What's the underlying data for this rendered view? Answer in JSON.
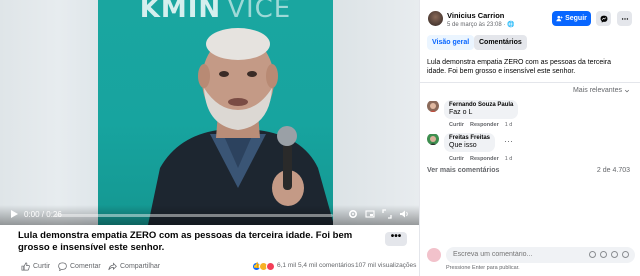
{
  "video": {
    "brand_text": "KMIN",
    "brand_text_right": "VICE",
    "time_display": "0:00 / 0:26",
    "progress_fraction": 0.0,
    "controls": [
      "play-icon",
      "volume-icon",
      "settings-icon",
      "pip-icon",
      "fullscreen-icon",
      "expand-icon"
    ]
  },
  "post": {
    "caption": "Lula demonstra empatia ZERO com as pessoas da terceira idade. Foi bem grosso e insensível este senhor.",
    "more_label": "•••",
    "actions": {
      "like": "Curtir",
      "comment": "Comentar",
      "share": "Compartilhar"
    },
    "reactions_count": "6,1 mil",
    "comments_count": "5,4 mil comentários",
    "views": "107 mil visualizações"
  },
  "panel": {
    "author": "Vinicius Carrion",
    "timestamp": "5 de março às 23:08 · 🌐",
    "follow_label": "Seguir",
    "tabs": [
      "Visão geral",
      "Comentários"
    ],
    "description": "Lula demonstra empatia ZERO com as pessoas da terceira idade. Foi bem grosso e insensível este senhor.",
    "sort_label": "Mais relevantes",
    "comments": [
      {
        "name": "Fernando Souza Paula",
        "text": "Faz o L",
        "like": "Curtir",
        "reply": "Responder",
        "age": "1 d"
      },
      {
        "name": "Freitas Freitas",
        "text": "Que isso",
        "like": "Curtir",
        "reply": "Responder",
        "age": "1 d"
      }
    ],
    "more_comments": "Ver mais comentários",
    "count_label": "2 de 4.703",
    "write_placeholder": "Escreva um comentário...",
    "enter_hint": "Pressione Enter para publicar."
  },
  "colors": {
    "accent": "#0866ff",
    "video_bg": "#17a49f",
    "muted_text": "#65676b",
    "bubble": "#f0f2f5"
  }
}
